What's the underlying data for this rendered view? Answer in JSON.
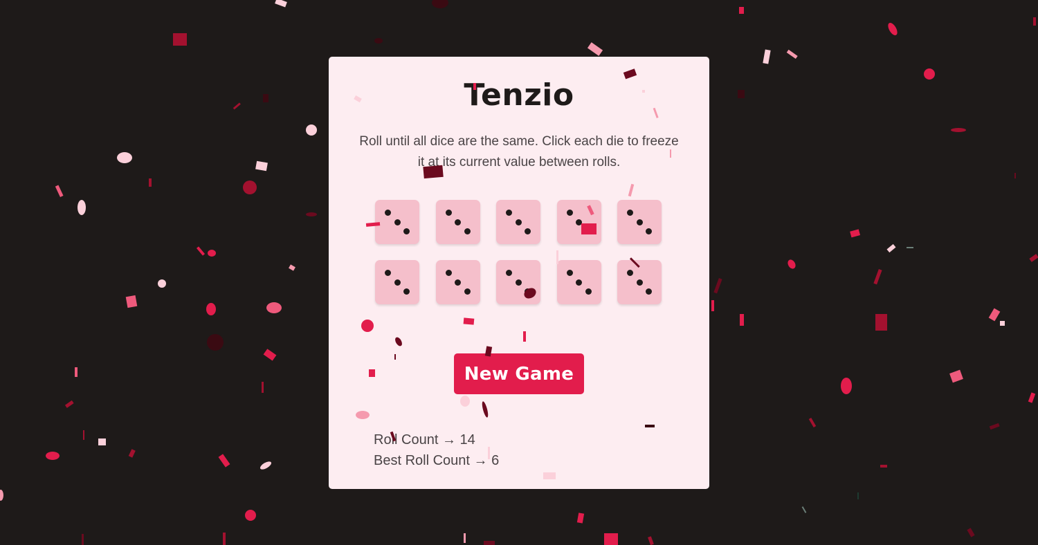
{
  "game": {
    "title": "Tenzio",
    "instructions": "Roll until all dice are the same. Click each die to freeze it at its current value between rolls.",
    "dice": [
      3,
      3,
      3,
      3,
      3,
      3,
      3,
      3,
      3,
      3
    ],
    "new_game_label": "New Game",
    "stats": {
      "roll_count_label": "Roll Count",
      "roll_count": "14",
      "best_roll_count_label": "Best Roll Count",
      "best_roll_count": "6",
      "arrow": "→"
    }
  },
  "colors": {
    "background": "#1e1a19",
    "card": "#fdedf1",
    "die_face": "#f5bfcb",
    "pip": "#1e1a19",
    "accent": "#e21d4c",
    "confetti": [
      "#e21d4c",
      "#a3112f",
      "#6b0a1f",
      "#f59aae",
      "#fbd0da",
      "#ee5a7c"
    ]
  }
}
